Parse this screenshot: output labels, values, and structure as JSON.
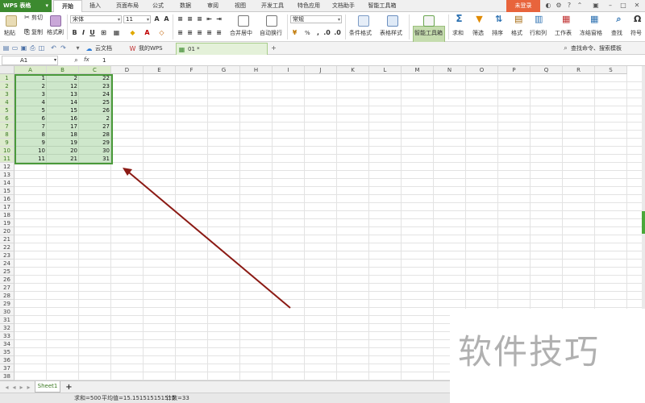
{
  "app": {
    "logo": "WPS 表格",
    "login": "未登录"
  },
  "menu": [
    "开始",
    "插入",
    "页面布局",
    "公式",
    "数据",
    "审阅",
    "视图",
    "开发工具",
    "特色应用",
    "文档助手",
    "智能工具箱"
  ],
  "ribbon": {
    "cut": "剪切",
    "paste": "粘贴",
    "copy": "复制",
    "format_painter": "格式刷",
    "font_name": "宋体",
    "font_size": "11",
    "merge_center": "合并居中",
    "wrap_text": "自动换行",
    "number_format": "常规",
    "percent": "%",
    "cond_format": "条件格式",
    "table_style": "表格样式",
    "smart_toolbox": "智能工具箱",
    "sum": "求和",
    "filter": "筛选",
    "sort": "排序",
    "format": "格式",
    "rows_cols": "行和列",
    "worksheet": "工作表",
    "freeze": "冻结窗格",
    "find": "查找",
    "symbol": "符号",
    "search_hint": "查找命令、搜索模板"
  },
  "docbar": {
    "tabs": [
      "云文档",
      "我的WPS",
      "01 *"
    ]
  },
  "formula_bar": {
    "name_box": "A1",
    "fx": "fx",
    "value": "1"
  },
  "grid": {
    "columns": [
      "A",
      "B",
      "C",
      "D",
      "E",
      "F",
      "G",
      "H",
      "I",
      "J",
      "K",
      "L",
      "M",
      "N",
      "O",
      "P",
      "Q",
      "R",
      "S"
    ],
    "row_numbers": [
      "1",
      "2",
      "3",
      "4",
      "5",
      "6",
      "7",
      "8",
      "9",
      "10",
      "11",
      "12",
      "13",
      "14",
      "15",
      "16",
      "17",
      "18",
      "19",
      "20",
      "21",
      "22",
      "23",
      "24",
      "25",
      "26",
      "27",
      "28",
      "29",
      "30",
      "31",
      "32",
      "33",
      "34",
      "35",
      "36",
      "37",
      "38"
    ],
    "data": [
      [
        "1",
        "2",
        "22"
      ],
      [
        "2",
        "12",
        "23"
      ],
      [
        "3",
        "13",
        "24"
      ],
      [
        "4",
        "14",
        "25"
      ],
      [
        "5",
        "15",
        "26"
      ],
      [
        "6",
        "16",
        "2"
      ],
      [
        "7",
        "17",
        "27"
      ],
      [
        "8",
        "18",
        "28"
      ],
      [
        "9",
        "19",
        "29"
      ],
      [
        "10",
        "20",
        "30"
      ],
      [
        "11",
        "21",
        "31"
      ]
    ]
  },
  "sheets": [
    "Sheet1"
  ],
  "status": {
    "sum": "求和=500",
    "avg": "平均值=15.151515151515",
    "count": "计数=33"
  },
  "watermark": "软件技巧",
  "colors": {
    "accent": "#4a9a3a",
    "arrow": "#8b1a14",
    "login": "#e8643c"
  }
}
